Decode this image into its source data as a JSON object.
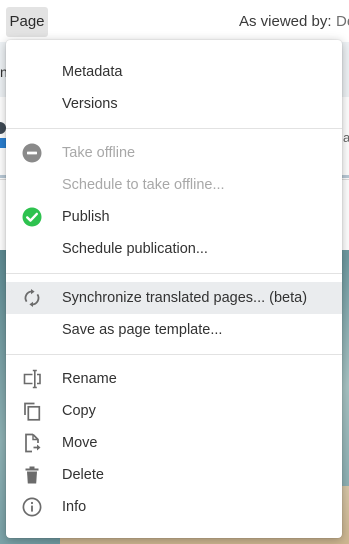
{
  "toolbar": {
    "page_label": "Page",
    "viewed_as_label": "As viewed by:",
    "viewed_as_value": "De"
  },
  "background": {
    "strip_fragment": "nt",
    "edge_fragment": "at"
  },
  "menu": {
    "groups": [
      {
        "items": [
          {
            "label": "Metadata",
            "icon": null,
            "enabled": true
          },
          {
            "label": "Versions",
            "icon": null,
            "enabled": true
          }
        ]
      },
      {
        "items": [
          {
            "label": "Take offline",
            "icon": "minus-circle-icon",
            "enabled": false
          },
          {
            "label": "Schedule to take offline...",
            "icon": null,
            "enabled": false
          },
          {
            "label": "Publish",
            "icon": "check-circle-icon",
            "enabled": true
          },
          {
            "label": "Schedule publication...",
            "icon": null,
            "enabled": true
          }
        ]
      },
      {
        "items": [
          {
            "label": "Synchronize translated pages... (beta)",
            "icon": "sync-icon",
            "enabled": true,
            "highlighted": true
          },
          {
            "label": "Save as page template...",
            "icon": null,
            "enabled": true
          }
        ]
      },
      {
        "items": [
          {
            "label": "Rename",
            "icon": "rename-icon",
            "enabled": true
          },
          {
            "label": "Copy",
            "icon": "copy-icon",
            "enabled": true
          },
          {
            "label": "Move",
            "icon": "move-icon",
            "enabled": true
          },
          {
            "label": "Delete",
            "icon": "trash-icon",
            "enabled": true
          },
          {
            "label": "Info",
            "icon": "info-icon",
            "enabled": true
          }
        ]
      }
    ]
  },
  "colors": {
    "publish_green": "#2ec24f",
    "offline_gray": "#8a8a8a",
    "highlight_bg": "#eaecee",
    "icon_gray": "#6b6b6b"
  }
}
